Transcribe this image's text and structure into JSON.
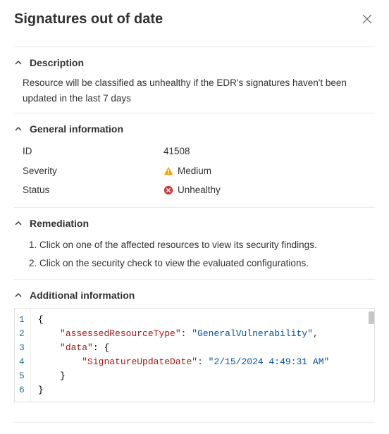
{
  "title": "Signatures out of date",
  "sections": {
    "description": {
      "heading": "Description",
      "text": "Resource will be classified as unhealthy if the EDR's signatures haven't been updated in the last 7 days"
    },
    "general": {
      "heading": "General information",
      "rows": [
        {
          "key": "ID",
          "value": "41508"
        },
        {
          "key": "Severity",
          "value": "Medium"
        },
        {
          "key": "Status",
          "value": "Unhealthy"
        }
      ]
    },
    "remediation": {
      "heading": "Remediation",
      "steps": [
        "Click on one of the affected resources to view its security findings.",
        "Click on the security check to view the evaluated configurations."
      ]
    },
    "additional": {
      "heading": "Additional information",
      "json": {
        "assessedResourceType": "GeneralVulnerability",
        "data": {
          "SignatureUpdateDate": "2/15/2024 4:49:31 AM"
        }
      },
      "code_lines": [
        {
          "n": "1",
          "indent": 0,
          "kind": "brace",
          "text": "{"
        },
        {
          "n": "2",
          "indent": 1,
          "kind": "kv",
          "key": "\"assessedResourceType\"",
          "val": "\"GeneralVulnerability\"",
          "trail": ","
        },
        {
          "n": "3",
          "indent": 1,
          "kind": "kopen",
          "key": "\"data\"",
          "text": ": {"
        },
        {
          "n": "4",
          "indent": 2,
          "kind": "kv",
          "key": "\"SignatureUpdateDate\"",
          "val": "\"2/15/2024 4:49:31 AM\"",
          "trail": ""
        },
        {
          "n": "5",
          "indent": 1,
          "kind": "brace",
          "text": "}"
        },
        {
          "n": "6",
          "indent": 0,
          "kind": "brace",
          "text": "}"
        }
      ]
    }
  }
}
